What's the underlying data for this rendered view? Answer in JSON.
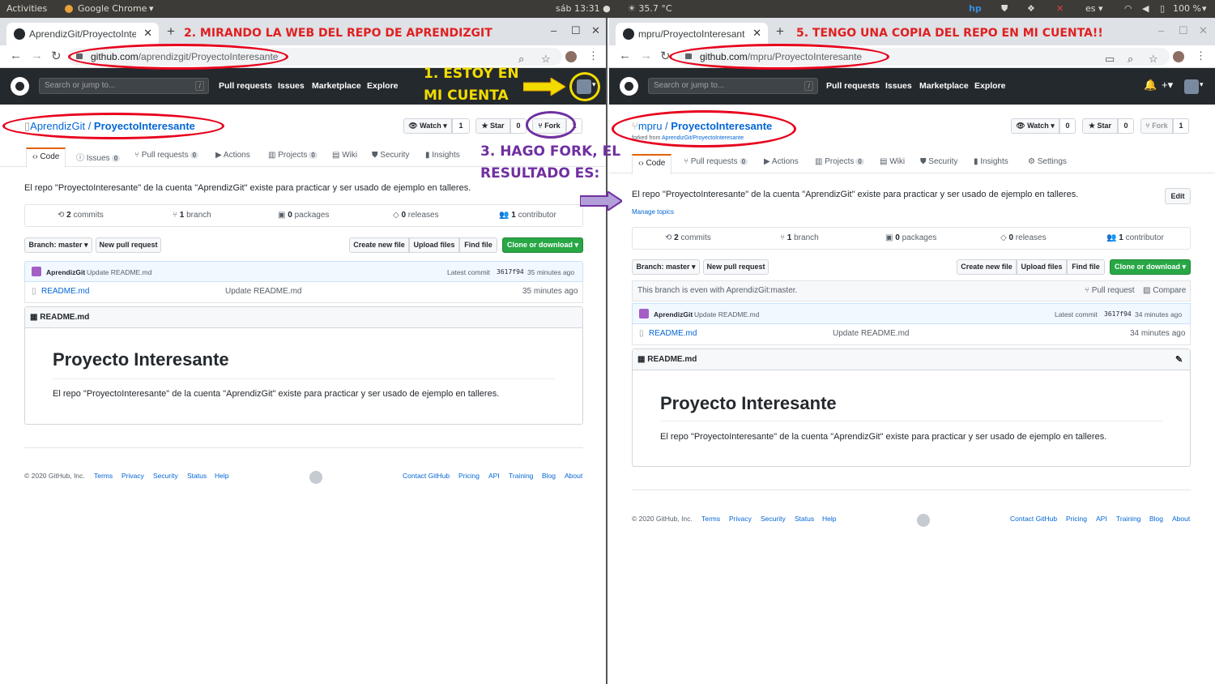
{
  "system_bar": {
    "activities": "Activities",
    "app": "Google Chrome",
    "app_menu": "▾",
    "clock": "sáb 13:31 ●",
    "weather": "☀ 35.7 °C",
    "lang": "es ▾",
    "battery": "100 %"
  },
  "left": {
    "tab_title": "AprendizGit/ProyectoInteresante",
    "url_host": "github.com",
    "url_path": "/aprendizgit/ProyectoInteresante",
    "search_placeholder": "Search or jump to...",
    "search_key": "/",
    "nav": [
      "Pull requests",
      "Issues",
      "Marketplace",
      "Explore"
    ],
    "owner": "AprendizGit",
    "sep": " / ",
    "repo": "ProyectoInteresante",
    "watch": "Watch ▾",
    "watch_count": "1",
    "star": "Star",
    "star_count": "0",
    "fork": "Fork",
    "fork_count": "1",
    "tabs": {
      "code": "Code",
      "issues": "Issues",
      "issues_count": "0",
      "prs": "Pull requests",
      "prs_count": "0",
      "actions": "Actions",
      "projects": "Projects",
      "projects_count": "0",
      "wiki": "Wiki",
      "security": "Security",
      "insights": "Insights"
    },
    "description": "El repo \"ProyectoInteresante\" de la cuenta \"AprendizGit\" existe para practicar y ser usado de ejemplo en talleres.",
    "summary": {
      "commits": "2",
      "commits_label": " commits",
      "branch": "1",
      "branch_label": " branch",
      "packages": "0",
      "packages_label": " packages",
      "releases": "0",
      "releases_label": " releases",
      "contrib": "1",
      "contrib_label": " contributor"
    },
    "branch_btn": "Branch: master ▾",
    "new_pr": "New pull request",
    "create_file": "Create new file",
    "upload": "Upload files",
    "find": "Find file",
    "clone": "Clone or download ▾",
    "commit_author": "AprendizGit",
    "commit_msg": "Update README.md",
    "latest": "Latest commit",
    "sha": "3617f94",
    "commit_time": "35 minutes ago",
    "file_name": "README.md",
    "file_msg": "Update README.md",
    "file_time": "35 minutes ago",
    "readme_title": "README.md",
    "readme_h1": "Proyecto Interesante",
    "readme_p": "El repo \"ProyectoInteresante\" de la cuenta \"AprendizGit\" existe para practicar y ser usado de ejemplo en talleres.",
    "footer": {
      "copy": "© 2020 GitHub, Inc.",
      "links_l": [
        "Terms",
        "Privacy",
        "Security",
        "Status",
        "Help"
      ],
      "links_r": [
        "Contact GitHub",
        "Pricing",
        "API",
        "Training",
        "Blog",
        "About"
      ]
    }
  },
  "right": {
    "tab_title": "mpru/ProyectoInteresante",
    "url_host": "github.com",
    "url_path": "/mpru/ProyectoInteresante",
    "search_placeholder": "Search or jump to...",
    "search_key": "/",
    "nav": [
      "Pull requests",
      "Issues",
      "Marketplace",
      "Explore"
    ],
    "owner": "mpru",
    "sep": " / ",
    "repo": "ProyectoInteresante",
    "forked_prefix": "forked from ",
    "forked_link": "AprendizGit/ProyectoInteresante",
    "watch": "Watch ▾",
    "watch_count": "0",
    "star": "Star",
    "star_count": "0",
    "fork": "Fork",
    "fork_count": "1",
    "tabs": {
      "code": "Code",
      "prs": "Pull requests",
      "prs_count": "0",
      "actions": "Actions",
      "projects": "Projects",
      "projects_count": "0",
      "wiki": "Wiki",
      "security": "Security",
      "insights": "Insights",
      "settings": "Settings"
    },
    "description": "El repo \"ProyectoInteresante\" de la cuenta \"AprendizGit\" existe para practicar y ser usado de ejemplo en talleres.",
    "edit": "Edit",
    "topics": "Manage topics",
    "summary": {
      "commits": "2",
      "commits_label": " commits",
      "branch": "1",
      "branch_label": " branch",
      "packages": "0",
      "packages_label": " packages",
      "releases": "0",
      "releases_label": " releases",
      "contrib": "1",
      "contrib_label": " contributor"
    },
    "branch_btn": "Branch: master ▾",
    "new_pr": "New pull request",
    "create_file": "Create new file",
    "upload": "Upload files",
    "find": "Find file",
    "clone": "Clone or download ▾",
    "even": "This branch is even with AprendizGit:master.",
    "pull_request": "Pull request",
    "compare": "Compare",
    "commit_author": "AprendizGit",
    "commit_msg": "Update README.md",
    "latest": "Latest commit",
    "sha": "3617f94",
    "commit_time": "34 minutes ago",
    "file_name": "README.md",
    "file_msg": "Update README.md",
    "file_time": "34 minutes ago",
    "readme_title": "README.md",
    "readme_h1": "Proyecto Interesante",
    "readme_p": "El repo \"ProyectoInteresante\" de la cuenta \"AprendizGit\" existe para practicar y ser usado de ejemplo en talleres.",
    "footer": {
      "copy": "© 2020 GitHub, Inc.",
      "links_l": [
        "Terms",
        "Privacy",
        "Security",
        "Status",
        "Help"
      ],
      "links_r": [
        "Contact GitHub",
        "Pricing",
        "API",
        "Training",
        "Blog",
        "About"
      ]
    }
  },
  "annotations": {
    "a1_line1": "1. ESTOY EN",
    "a1_line2": "MI CUENTA",
    "a2": "2. MIRANDO LA WEB DEL REPO DE APRENDIZGIT",
    "a3_line1": "3. HAGO FORK, EL",
    "a3_line2": "RESULTADO ES:",
    "a5": "5. TENGO UNA COPIA DEL REPO EN MI CUENTA!!"
  },
  "colors": {
    "annotation_red": "#e02020",
    "annotation_yellow": "#f2dc00",
    "annotation_purple": "#7030a0",
    "github_header": "#24292e",
    "link_blue": "#0366d6",
    "clone_green": "#28a745"
  }
}
